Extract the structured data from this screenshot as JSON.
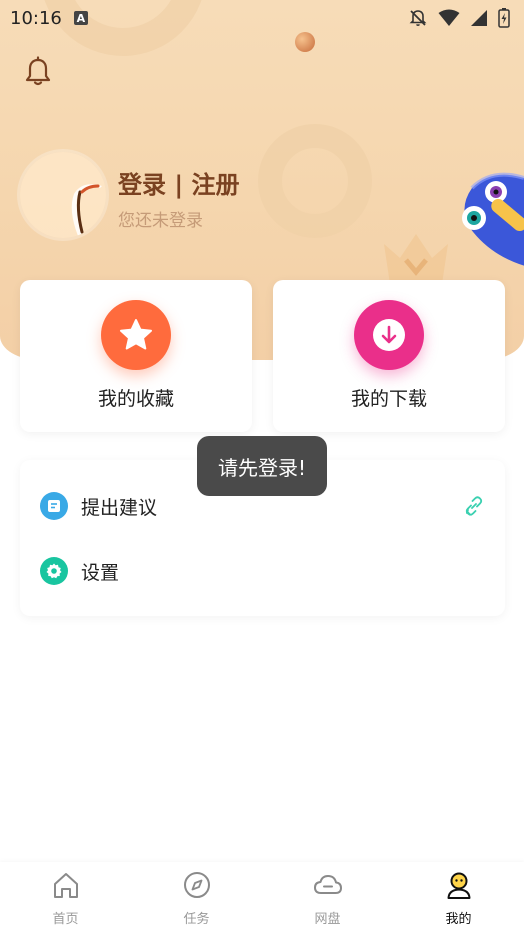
{
  "status_bar": {
    "time": "10:16",
    "notification_icon": "A"
  },
  "profile": {
    "title": "登录 | 注册",
    "subtitle": "您还未登录"
  },
  "quick_cards": [
    {
      "label": "我的收藏",
      "icon": "star-icon",
      "color": "#ff6b3d"
    },
    {
      "label": "我的下载",
      "icon": "download-icon",
      "color": "#ea2f8a"
    }
  ],
  "menu": {
    "items": [
      {
        "label": "提出建议",
        "icon": "note-icon",
        "color": "#39a9e6"
      },
      {
        "label": "设置",
        "icon": "gear-icon",
        "color": "#19c5a0"
      }
    ]
  },
  "toast": {
    "text": "请先登录!"
  },
  "tabbar": {
    "tabs": [
      {
        "label": "首页",
        "icon": "home-icon"
      },
      {
        "label": "任务",
        "icon": "compass-icon"
      },
      {
        "label": "网盘",
        "icon": "cloud-icon"
      },
      {
        "label": "我的",
        "icon": "user-icon"
      }
    ],
    "active": "我的"
  },
  "colors": {
    "header_bg": "#f5d6ae",
    "title_brown": "#7a4221",
    "subtitle_tan": "#c59b78",
    "link_teal": "#3ad0b0"
  }
}
